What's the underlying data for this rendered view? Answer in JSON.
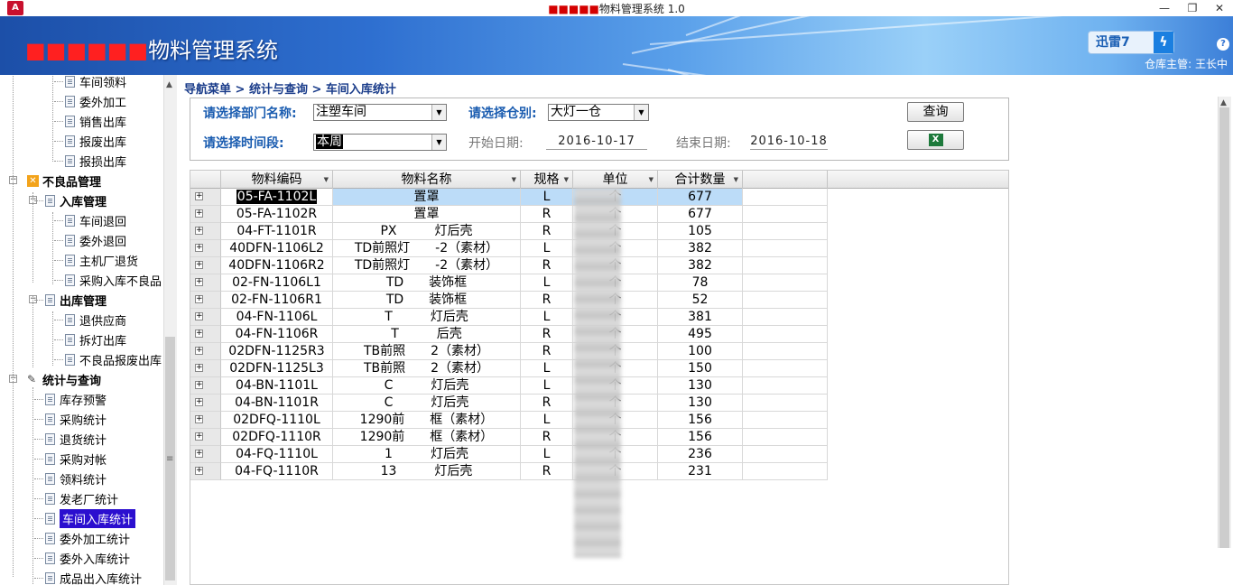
{
  "window": {
    "title_redacted": "■■■■■",
    "title": "物料管理系统 1.0",
    "app_icon": "A"
  },
  "banner": {
    "title_redacted": "■■■■■■",
    "title": "物料管理系统",
    "xunlei_label": "迅雷7",
    "user_label": "仓库主管: 王长中"
  },
  "sidebar": {
    "items": [
      {
        "label": "车间领料",
        "level": 2
      },
      {
        "label": "委外加工",
        "level": 2
      },
      {
        "label": "销售出库",
        "level": 2
      },
      {
        "label": "报废出库",
        "level": 2
      },
      {
        "label": "报损出库",
        "level": 2
      },
      {
        "label": "不良品管理",
        "level": 0
      },
      {
        "label": "入库管理",
        "level": 1
      },
      {
        "label": "车间退回",
        "level": 2
      },
      {
        "label": "委外退回",
        "level": 2
      },
      {
        "label": "主机厂退货",
        "level": 2
      },
      {
        "label": "采购入库不良品",
        "level": 2
      },
      {
        "label": "出库管理",
        "level": 1
      },
      {
        "label": "退供应商",
        "level": 2
      },
      {
        "label": "拆灯出库",
        "level": 2
      },
      {
        "label": "不良品报废出库",
        "level": 2
      },
      {
        "label": "统计与查询",
        "level": 0
      },
      {
        "label": "库存预警",
        "level": 1
      },
      {
        "label": "采购统计",
        "level": 1
      },
      {
        "label": "退货统计",
        "level": 1
      },
      {
        "label": "采购对帐",
        "level": 1
      },
      {
        "label": "领料统计",
        "level": 1
      },
      {
        "label": "发老厂统计",
        "level": 1
      },
      {
        "label": "车间入库统计",
        "level": 1,
        "selected": true
      },
      {
        "label": "委外加工统计",
        "level": 1
      },
      {
        "label": "委外入库统计",
        "level": 1
      },
      {
        "label": "成品出入库统计",
        "level": 1
      }
    ]
  },
  "breadcrumb": "导航菜单 > 统计与查询 > 车间入库统计",
  "filters": {
    "dept_label": "请选择部门名称:",
    "dept_value": "注塑车间",
    "warehouse_label": "请选择仓别:",
    "warehouse_value": "大灯一仓",
    "period_label": "请选择时间段:",
    "period_value": "本周",
    "start_label": "开始日期:",
    "start_value": "2016-10-17",
    "end_label": "结束日期:",
    "end_value": "2016-10-18",
    "query_button": "查询",
    "excel_icon": "X"
  },
  "grid": {
    "columns": [
      "物料编码",
      "物料名称",
      "规格",
      "单位",
      "合计数量"
    ],
    "rows": [
      {
        "code": "05-FA-1102L",
        "name": "置罩",
        "spec": "L",
        "unit": "个",
        "qty": "677"
      },
      {
        "code": "05-FA-1102R",
        "name": "置罩",
        "spec": "R",
        "unit": "个",
        "qty": "677"
      },
      {
        "code": "04-FT-1101R",
        "name": "PX　　　灯后壳",
        "spec": "R",
        "unit": "个",
        "qty": "105"
      },
      {
        "code": "40DFN-1106L2",
        "name": "TD前照灯　　-2（素材）",
        "spec": "L",
        "unit": "个",
        "qty": "382"
      },
      {
        "code": "40DFN-1106R2",
        "name": "TD前照灯　　-2（素材）",
        "spec": "R",
        "unit": "个",
        "qty": "382"
      },
      {
        "code": "02-FN-1106L1",
        "name": "TD　　装饰框",
        "spec": "L",
        "unit": "个",
        "qty": "78"
      },
      {
        "code": "02-FN-1106R1",
        "name": "TD　　装饰框",
        "spec": "R",
        "unit": "个",
        "qty": "52"
      },
      {
        "code": "04-FN-1106L",
        "name": "T　　　灯后壳",
        "spec": "L",
        "unit": "个",
        "qty": "381"
      },
      {
        "code": "04-FN-1106R",
        "name": "T　　　后壳",
        "spec": "R",
        "unit": "个",
        "qty": "495"
      },
      {
        "code": "02DFN-1125R3",
        "name": "TB前照　　2（素材）",
        "spec": "R",
        "unit": "个",
        "qty": "100"
      },
      {
        "code": "02DFN-1125L3",
        "name": "TB前照　　2（素材）",
        "spec": "L",
        "unit": "个",
        "qty": "150"
      },
      {
        "code": "04-BN-1101L",
        "name": "C　　　灯后壳",
        "spec": "L",
        "unit": "个",
        "qty": "130"
      },
      {
        "code": "04-BN-1101R",
        "name": "C　　　灯后壳",
        "spec": "R",
        "unit": "个",
        "qty": "130"
      },
      {
        "code": "02DFQ-1110L",
        "name": "1290前　　框（素材）",
        "spec": "L",
        "unit": "个",
        "qty": "156"
      },
      {
        "code": "02DFQ-1110R",
        "name": "1290前　　框（素材）",
        "spec": "R",
        "unit": "个",
        "qty": "156"
      },
      {
        "code": "04-FQ-1110L",
        "name": "1　　　灯后壳",
        "spec": "L",
        "unit": "个",
        "qty": "236"
      },
      {
        "code": "04-FQ-1110R",
        "name": "13　　　灯后壳",
        "spec": "R",
        "unit": "个",
        "qty": "231"
      }
    ]
  },
  "colors": {
    "banner_blue": "#2e6fd0",
    "label_blue": "#1a5cb0",
    "selected_item": "#2b0fcf",
    "row_selected": "#bcdcf8"
  }
}
